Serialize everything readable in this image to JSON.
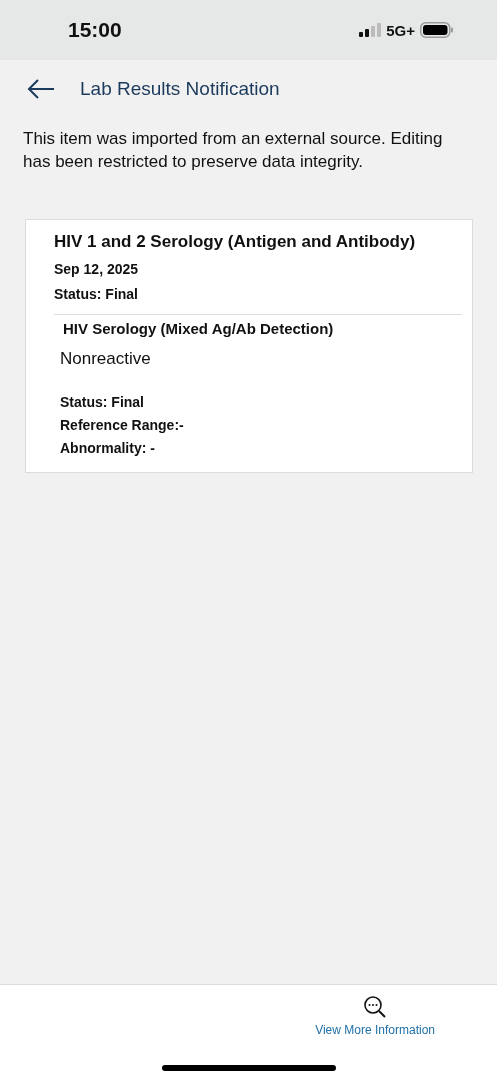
{
  "status_bar": {
    "time": "15:00",
    "network": "5G+"
  },
  "header": {
    "title": "Lab Results Notification"
  },
  "notice": "This item was imported from an external source. Editing has been restricted to preserve data integrity.",
  "card": {
    "title": "HIV 1 and 2 Serology (Antigen and Antibody)",
    "date": "Sep 12, 2025",
    "status": "Status: Final",
    "result": {
      "name": "HIV Serology (Mixed Ag/Ab Detection)",
      "value": "Nonreactive",
      "status": "Status: Final",
      "reference_range": "Reference Range:-",
      "abnormality": "Abnormality: -"
    }
  },
  "footer": {
    "action": "View More Information"
  }
}
